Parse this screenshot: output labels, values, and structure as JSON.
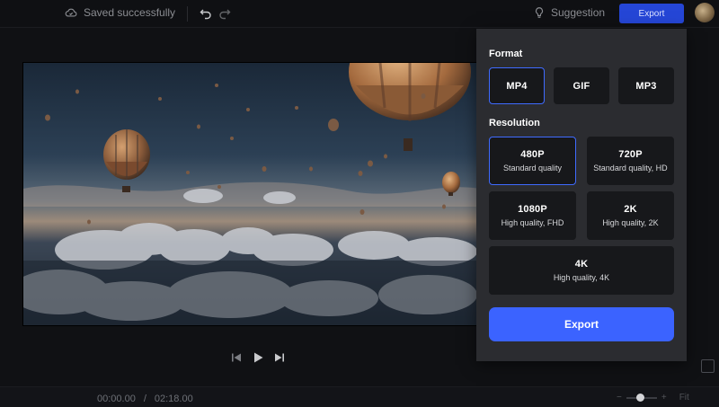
{
  "header": {
    "save_status": "Saved successfully",
    "suggestion_label": "Suggestion",
    "export_label": "Export",
    "icons": {
      "saved": "cloud-check-icon",
      "undo": "undo-icon",
      "redo": "redo-icon",
      "suggestion": "lightbulb-icon"
    }
  },
  "player": {
    "current_time": "00:00.00",
    "separator": "/",
    "total_time": "02:18.00",
    "fit_label": "Fit",
    "zoom_level": 0.35,
    "icons": {
      "prev": "skip-back-icon",
      "play": "play-icon",
      "next": "skip-forward-icon",
      "fullscreen": "fullscreen-icon"
    }
  },
  "export_panel": {
    "format_title": "Format",
    "formats": [
      {
        "label": "MP4",
        "selected": true
      },
      {
        "label": "GIF",
        "selected": false
      },
      {
        "label": "MP3",
        "selected": false
      }
    ],
    "resolution_title": "Resolution",
    "resolutions": [
      {
        "label": "480P",
        "desc": "Standard quality",
        "selected": true
      },
      {
        "label": "720P",
        "desc": "Standard quality, HD",
        "selected": false
      },
      {
        "label": "1080P",
        "desc": "High quality, FHD",
        "selected": false
      },
      {
        "label": "2K",
        "desc": "High quality, 2K",
        "selected": false
      },
      {
        "label": "4K",
        "desc": "High quality, 4K",
        "selected": false
      }
    ],
    "export_button": "Export"
  },
  "colors": {
    "accent": "#3b63ff",
    "top_export": "#2546d6",
    "panel_bg": "#2b2c30",
    "option_bg": "#17181b"
  }
}
